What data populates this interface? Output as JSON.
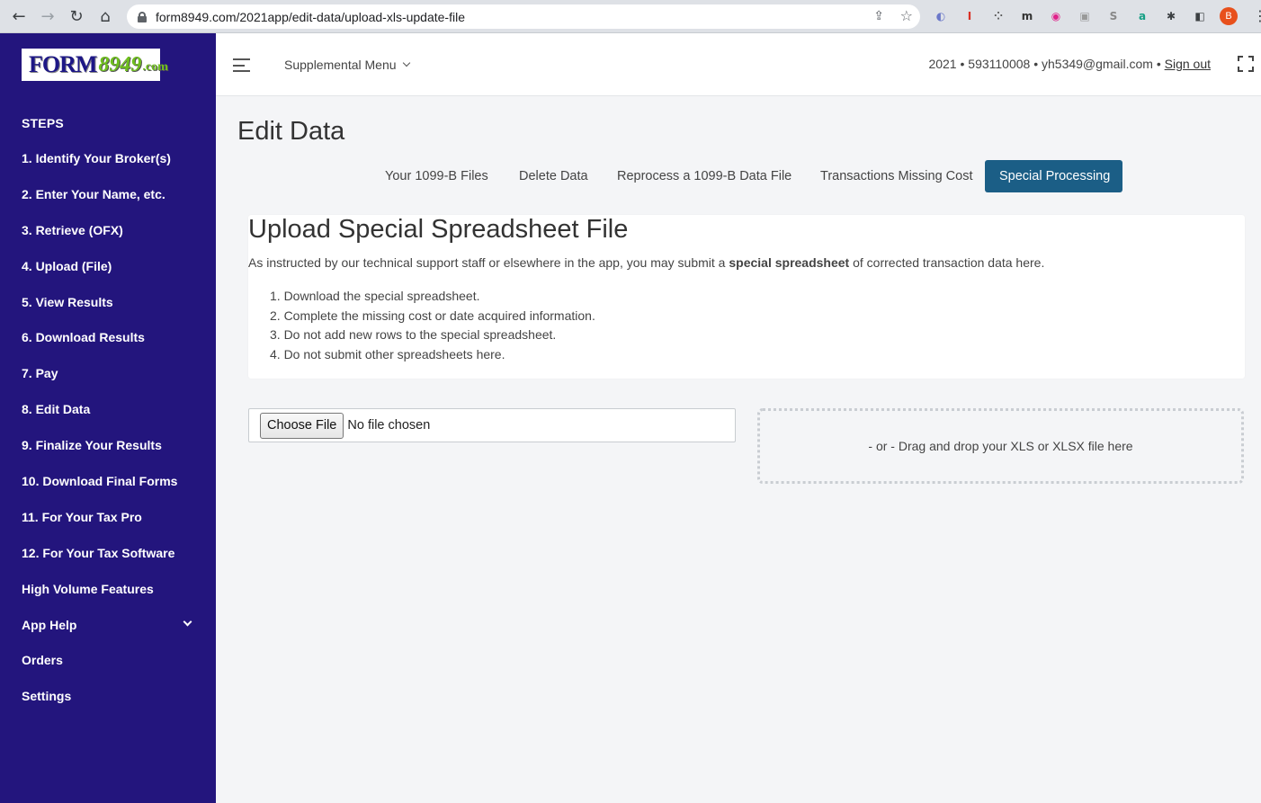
{
  "browser": {
    "url": "form8949.com/2021app/edit-data/upload-xls-update-file",
    "profile_initial": "B",
    "extensions": [
      {
        "name": "extension-icon-1",
        "glyph": "◐",
        "color": "#6b78c9"
      },
      {
        "name": "extension-icon-2",
        "glyph": "I",
        "color": "#d93025"
      },
      {
        "name": "extension-icon-3",
        "glyph": "⁘",
        "color": "#555"
      },
      {
        "name": "extension-icon-4",
        "glyph": "m",
        "color": "#333"
      },
      {
        "name": "extension-icon-5",
        "glyph": "◉",
        "color": "#e0218a"
      },
      {
        "name": "extension-icon-6",
        "glyph": "▣",
        "color": "#999"
      },
      {
        "name": "extension-icon-7",
        "glyph": "S",
        "color": "#888"
      },
      {
        "name": "extension-icon-8",
        "glyph": "a",
        "color": "#16a085"
      },
      {
        "name": "puzzle-icon",
        "glyph": "✱",
        "color": "#3c4043"
      },
      {
        "name": "side-panel-icon",
        "glyph": "◧",
        "color": "#3c4043"
      }
    ]
  },
  "logo": {
    "form": "FORM",
    "num": "8949",
    "com": ".com"
  },
  "sidebar": {
    "steps_label": "STEPS",
    "items": [
      {
        "label": "1. Identify Your Broker(s)"
      },
      {
        "label": "2. Enter Your Name, etc."
      },
      {
        "label": "3. Retrieve (OFX)"
      },
      {
        "label": "4. Upload (File)"
      },
      {
        "label": "5. View Results"
      },
      {
        "label": "6. Download Results"
      },
      {
        "label": "7. Pay"
      },
      {
        "label": "8. Edit Data"
      },
      {
        "label": "9. Finalize Your Results"
      },
      {
        "label": "10. Download Final Forms"
      },
      {
        "label": "11. For Your Tax Pro"
      },
      {
        "label": "12. For Your Tax Software"
      },
      {
        "label": "High Volume Features"
      },
      {
        "label": "App Help"
      },
      {
        "label": "Orders"
      },
      {
        "label": "Settings"
      }
    ]
  },
  "header": {
    "supplemental_menu": "Supplemental Menu",
    "user_info": "2021 • 593110008 • yh5349@gmail.com •",
    "sign_out": "Sign out"
  },
  "main": {
    "title": "Edit Data",
    "tabs": [
      {
        "label": "Your 1099-B Files"
      },
      {
        "label": "Delete Data"
      },
      {
        "label": "Reprocess a 1099-B Data File"
      },
      {
        "label": "Transactions Missing Cost"
      },
      {
        "label": "Special Processing"
      }
    ],
    "card": {
      "heading": "Upload Special Spreadsheet File",
      "intro_before": "As instructed by our technical support staff or elsewhere in the app, you may submit a ",
      "intro_bold": "special spreadsheet",
      "intro_after": " of corrected transaction data here.",
      "steps": [
        "1. Download the special spreadsheet.",
        "2. Complete the missing cost or date acquired information.",
        "3. Do not add new rows to the special spreadsheet.",
        "4. Do not submit other spreadsheets here."
      ]
    },
    "file_button": "Choose File",
    "file_status": "No file chosen",
    "dropzone_text": "- or - Drag and drop your XLS or XLSX file here"
  },
  "colors": {
    "sidebar_bg": "#23157d",
    "active_tab": "#1b5e86"
  }
}
